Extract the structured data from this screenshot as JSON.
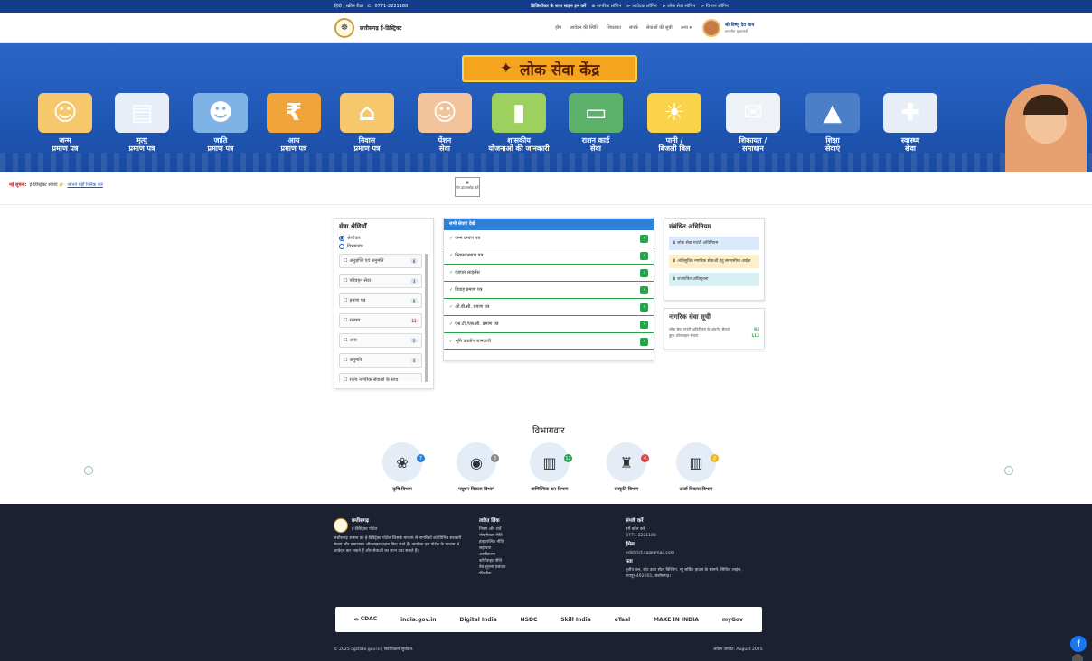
{
  "topbar": {
    "lang": "हिंदी | स्क्रीन रीडर",
    "phone": "0771-2221188",
    "track": "डिजिलॉकर के साथ साइन इन करें",
    "links": [
      "नागरिक लॉगिन",
      "आवेदक लॉगिन",
      "लोक सेवा लॉगिन",
      "विभाग लॉगिन"
    ]
  },
  "header": {
    "title": "छत्तीसगढ़ ई-डिस्ट्रिक्ट",
    "nav": [
      "होम",
      "आवेदन की स्थिति",
      "शिकायत",
      "संपर्क",
      "सेवाओं की सूची",
      "अन्य"
    ],
    "user_name": "श्री विष्णु देव साय",
    "user_role": "माननीय मुख्यमंत्री"
  },
  "banner": {
    "title": "लोक सेवा केंद्र",
    "services": [
      {
        "l1": "जन्म",
        "l2": "प्रमाण पत्र",
        "icon": "baby-icon",
        "glyph": "☺",
        "color": "#f6c76b"
      },
      {
        "l1": "मृत्यु",
        "l2": "प्रमाण पत्र",
        "icon": "candle-icon",
        "glyph": "▤",
        "color": "#e7eef8"
      },
      {
        "l1": "जाति",
        "l2": "प्रमाण पत्र",
        "icon": "people-icon",
        "glyph": "☻",
        "color": "#7fb3e6"
      },
      {
        "l1": "आय",
        "l2": "प्रमाण पत्र",
        "icon": "rupee-icon",
        "glyph": "₹",
        "color": "#f0a43a"
      },
      {
        "l1": "निवास",
        "l2": "प्रमाण पत्र",
        "icon": "house-icon",
        "glyph": "⌂",
        "color": "#f6c76b"
      },
      {
        "l1": "पेंशन",
        "l2": "सेवा",
        "icon": "elder-icon",
        "glyph": "☺",
        "color": "#f3c39b"
      },
      {
        "l1": "शासकीय",
        "l2": "योजनाओं की जानकारी",
        "icon": "growth-icon",
        "glyph": "▮",
        "color": "#9dd05f"
      },
      {
        "l1": "राशन कार्ड",
        "l2": "सेवा",
        "icon": "ration-card-icon",
        "glyph": "▭",
        "color": "#5bb16a"
      },
      {
        "l1": "पानी /",
        "l2": "बिजली बिल",
        "icon": "water-bulb-icon",
        "glyph": "☀",
        "color": "#fbd34a"
      },
      {
        "l1": "शिकायत /",
        "l2": "समाधान",
        "icon": "mail-check-icon",
        "glyph": "✉",
        "color": "#eef2f6"
      },
      {
        "l1": "शिक्षा",
        "l2": "सेवाएं",
        "icon": "graduation-icon",
        "glyph": "▲",
        "color": "#4d7fc8"
      },
      {
        "l1": "स्वास्थ्य",
        "l2": "सेवा",
        "icon": "hospital-icon",
        "glyph": "✚",
        "color": "#e8eef7"
      }
    ]
  },
  "notice": {
    "label": "नई सूचना:",
    "text": "ई-डिस्ट्रिक्ट सेवाएं 👉",
    "link": "जानने यहाँ क्लिक करें",
    "qr": "ऐप डाउनलोड करें"
  },
  "categories": {
    "title": "सेवा श्रेणियाँ",
    "radio1": "श्रेणीवार",
    "radio2": "विभागवार",
    "items": [
      {
        "label": "अनुज्ञप्ति एवं अनुमति",
        "count": "8",
        "bg": "#dbe7f7"
      },
      {
        "label": "परिवहन सेवा",
        "count": "3",
        "bg": "#dbe7f7"
      },
      {
        "label": "प्रमाण पत्र",
        "count": "9",
        "bg": "#dff2e3"
      },
      {
        "label": "राजस्व",
        "count": "11",
        "bg": "#fde0e0"
      },
      {
        "label": "अन्य",
        "count": "2",
        "bg": "#dbe7f7"
      },
      {
        "label": "अनुमति",
        "count": "4",
        "bg": "#dff2e3"
      },
      {
        "label": "राज्य नागरिक सेवाओं के साथ",
        "count": "",
        "bg": "#fafafa"
      }
    ]
  },
  "all_services": {
    "title": "सभी सेवाएं देखें",
    "items": [
      "जन्म प्रमाण पत्र",
      "निवास प्रमाण पत्र",
      "व्यापार लाइसेंस",
      "विवाह प्रमाण पत्र",
      "ओ.बी.सी. प्रमाण पत्र",
      "एस.टी./एस.सी. प्रमाण पत्र",
      "भूमि उपयोग जानकारी"
    ]
  },
  "acts": {
    "title": "संबंधित अधिनियम",
    "items": [
      {
        "label": "⬇ लोक सेवा गारंटी अधिनियम",
        "bg": "#dbe9fb"
      },
      {
        "label": "⬇ अधिसूचित नागरिक सेवाओं हेतु समयसीमा आदेश",
        "bg": "#fdefc9"
      },
      {
        "label": "⬇ राजपत्रित अधिसूचना",
        "bg": "#d8f0f4"
      }
    ]
  },
  "citizen": {
    "title": "नागरिक सेवा सूची",
    "rows": [
      {
        "label": "लोक सेवा गारंटी अधिनियम के अंतर्गत सेवाएं",
        "num": "83"
      },
      {
        "label": "कुल ऑनलाइन सेवाएं",
        "num": "112"
      }
    ]
  },
  "departments": {
    "title": "विभागवार",
    "items": [
      {
        "name": "कृषि विभाग",
        "count": "7",
        "color": "#2f80d9",
        "glyph": "❀"
      },
      {
        "name": "पशुधन विकास विभाग",
        "count": "3",
        "color": "#888888",
        "glyph": "◉"
      },
      {
        "name": "वाणिज्यिक कर विभाग",
        "count": "12",
        "color": "#25a24c",
        "glyph": "▥"
      },
      {
        "name": "संस्कृति विभाग",
        "count": "4",
        "color": "#e04848",
        "glyph": "♜"
      },
      {
        "name": "ऊर्जा विकास विभाग",
        "count": "2",
        "color": "#f0b629",
        "glyph": "▥"
      }
    ]
  },
  "footer": {
    "brand": "छत्तीसगढ़",
    "brand_sub": "ई-डिस्ट्रिक्ट पोर्टल",
    "about": "छत्तीसगढ़ शासन का ई-डिस्ट्रिक्ट पोर्टल जिसके माध्यम से नागरिकों को विभिन्न सरकारी सेवाएं और प्रमाणपत्र ऑनलाइन प्रदान किए जाते हैं। नागरिक इस पोर्टल के माध्यम से आवेदन कर सकते हैं और सेवाओं का लाभ उठा सकते हैं।",
    "links_title": "त्वरित लिंक",
    "links": [
      "नियम और शर्तें",
      "गोपनीयता नीति",
      "हाइपरलिंक नीति",
      "सहायता",
      "अस्वीकरण",
      "कॉपीराइट नीति",
      "वेब सूचना प्रबंधक",
      "फीडबैक"
    ],
    "contact_title": "संपर्क करें",
    "contact_label": "हमें कॉल करें",
    "phone": "0771-2221188",
    "email_label": "ईमेल",
    "email": "edistrict.cg@gmail.com",
    "addr_label": "पता",
    "address": "तृतीय तल, स्टेट डाटा सेंटर बिल्डिंग, न्यू सर्किट हाउस के सामने, सिविल लाइंस, रायपुर-492001, छत्तीसगढ़।",
    "partners": [
      "⌓ CDAC",
      "india.gov.in",
      "Digital India",
      "NSDC",
      "Skill India",
      "eTaal",
      "MAKE IN INDIA",
      "myGov"
    ],
    "copyright": "© 2025 cgstate.gov.in | सर्वाधिकार सुरक्षित.",
    "updated": "अंतिम अपडेट: August 2025"
  }
}
